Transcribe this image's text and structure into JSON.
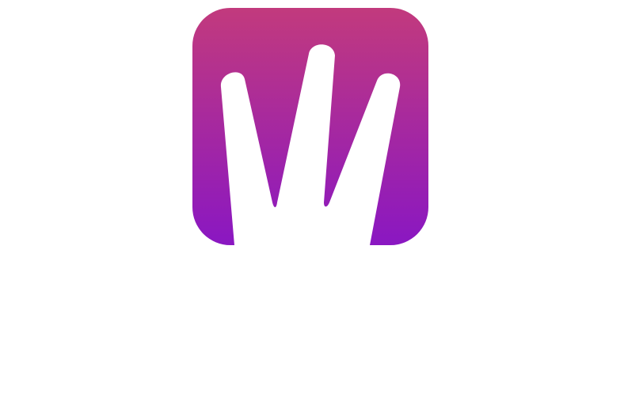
{
  "app_icon": {
    "icon": "hand-three-fingers-icon",
    "gradient_top": "#c23a7d",
    "gradient_bottom": "#8a17c2",
    "glyph_color": "#ffffff"
  }
}
